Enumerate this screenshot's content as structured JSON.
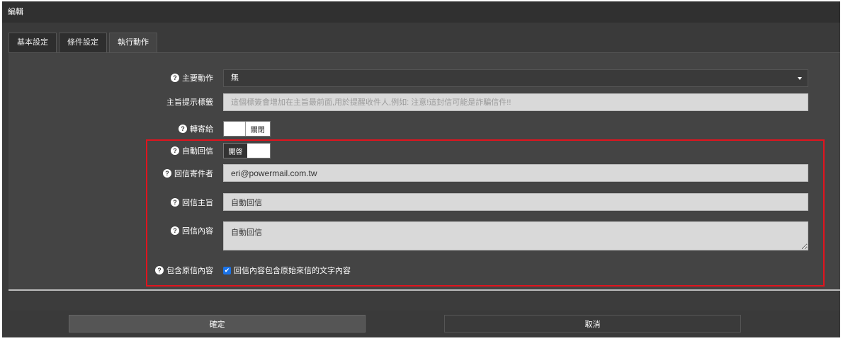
{
  "window": {
    "title": "編輯"
  },
  "tabs": [
    {
      "label": "基本設定",
      "active": false
    },
    {
      "label": "條件設定",
      "active": false
    },
    {
      "label": "執行動作",
      "active": true
    }
  ],
  "form": {
    "main_action": {
      "label": "主要動作",
      "value": "無"
    },
    "subject_tag": {
      "label": "主旨提示標籤",
      "placeholder": "這個標簽會增加在主旨最前面,用於提醒收件人,例如: 注意!這封信可能是詐騙信件!!"
    },
    "forward_to": {
      "label": "轉寄給",
      "toggle_text": "關閉",
      "state": "off"
    },
    "auto_reply": {
      "label": "自動回信",
      "toggle_text": "開啓",
      "state": "on"
    },
    "reply_sender": {
      "label": "回信寄件者",
      "value": "eri@powermail.com.tw"
    },
    "reply_subject": {
      "label": "回信主旨",
      "value": "自動回信"
    },
    "reply_content": {
      "label": "回信內容",
      "value": "自動回信"
    },
    "include_original": {
      "label": "包含原信內容",
      "checkbox_text": "回信內容包含原始來信的文字內容",
      "checked": true
    }
  },
  "buttons": {
    "confirm_label": "確定",
    "cancel_label": "取消"
  },
  "icons": {
    "help": "question-circle-icon",
    "check": "check-icon",
    "caret": "caret-down-icon"
  },
  "colors": {
    "highlight": "#e0141e",
    "checkbox": "#1a73e8"
  }
}
